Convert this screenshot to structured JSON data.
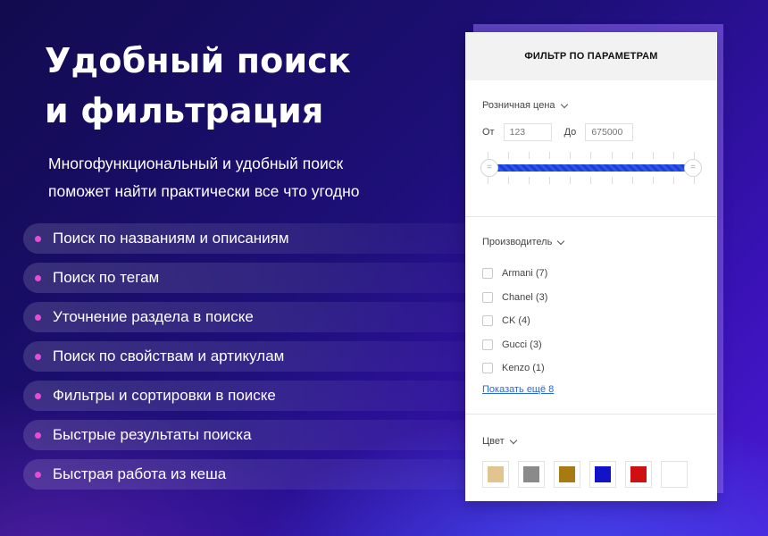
{
  "title": {
    "line1": "Удобный поиск",
    "line2": "и фильтрация"
  },
  "subtitle": {
    "line1": "Многофункциональный и удобный поиск",
    "line2": "поможет найти практически все что угодно"
  },
  "features": [
    "Поиск по названиям и описаниям",
    "Поиск по тегам",
    "Уточнение раздела в поиске",
    "Поиск по свойствам и артикулам",
    "Фильтры и сортировки в поиске",
    "Быстрые результаты поиска",
    "Быстрая работа из кеша"
  ],
  "filter": {
    "header": "ФИЛЬТР ПО ПАРАМЕТРАМ",
    "price": {
      "title": "Розничная цена",
      "from_label": "От",
      "from_placeholder": "123",
      "to_label": "До",
      "to_placeholder": "675000",
      "handle_icon": "grip-lines-icon"
    },
    "manufacturer": {
      "title": "Производитель",
      "items": [
        "Armani (7)",
        "Chanel (3)",
        "CK (4)",
        "Gucci (3)",
        "Kenzo (1)"
      ],
      "more_link": "Показать ещё 8"
    },
    "color": {
      "title": "Цвет",
      "swatches": [
        "#e2c48e",
        "#8a8a8a",
        "#a87a12",
        "#1212c8",
        "#d01010",
        "#ffffff"
      ]
    }
  },
  "colors": {
    "bullet": "#e84bd6",
    "accent_blue": "#1a3fd1",
    "link": "#2a67d8"
  }
}
